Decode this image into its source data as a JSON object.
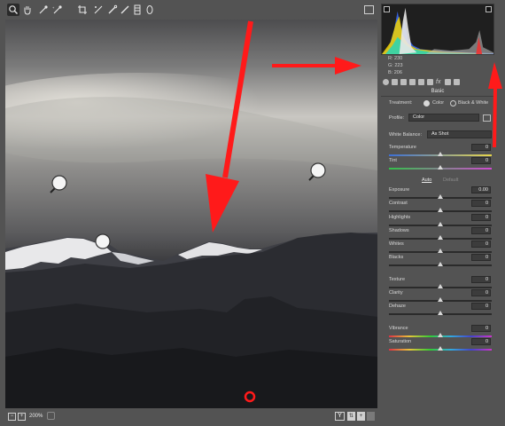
{
  "toolbar": {
    "tools": [
      "zoom-icon",
      "hand-icon",
      "white-balance-icon",
      "color-sampler-icon",
      "crop-icon",
      "straighten-icon",
      "spot-removal-icon",
      "brush-icon",
      "graduated-filter-icon",
      "radial-filter-icon"
    ],
    "active_tool": "zoom-icon"
  },
  "histogram": {
    "r_label": "R:",
    "r_value": "230",
    "g_label": "G:",
    "g_value": "223",
    "b_label": "B:",
    "b_value": "206"
  },
  "panel": {
    "section_title": "Basic",
    "treatment_label": "Treatment:",
    "treatment_color": "Color",
    "treatment_bw": "Black & White",
    "profile_label": "Profile:",
    "profile_value": "Color",
    "wb_label": "White Balance:",
    "wb_value": "As Shot",
    "auto_label": "Auto",
    "default_label": "Default",
    "sliders": [
      {
        "label": "Temperature",
        "value": "0",
        "pos": 0.5
      },
      {
        "label": "Tint",
        "value": "0",
        "pos": 0.5
      },
      {
        "label": "Exposure",
        "value": "0.00",
        "pos": 0.5
      },
      {
        "label": "Contrast",
        "value": "0",
        "pos": 0.5
      },
      {
        "label": "Highlights",
        "value": "0",
        "pos": 0.5
      },
      {
        "label": "Shadows",
        "value": "0",
        "pos": 0.5
      },
      {
        "label": "Whites",
        "value": "0",
        "pos": 0.5
      },
      {
        "label": "Blacks",
        "value": "0",
        "pos": 0.5
      },
      {
        "label": "Texture",
        "value": "0",
        "pos": 0.5
      },
      {
        "label": "Clarity",
        "value": "0",
        "pos": 0.5
      },
      {
        "label": "Dehaze",
        "value": "0",
        "pos": 0.5
      },
      {
        "label": "Vibrance",
        "value": "0",
        "pos": 0.5
      },
      {
        "label": "Saturation",
        "value": "0",
        "pos": 0.5
      }
    ]
  },
  "bottombar": {
    "zoom_value": "200%",
    "view_mode": "Y"
  },
  "colors": {
    "annotation": "#ff1a1a",
    "panel_bg": "#535353"
  }
}
